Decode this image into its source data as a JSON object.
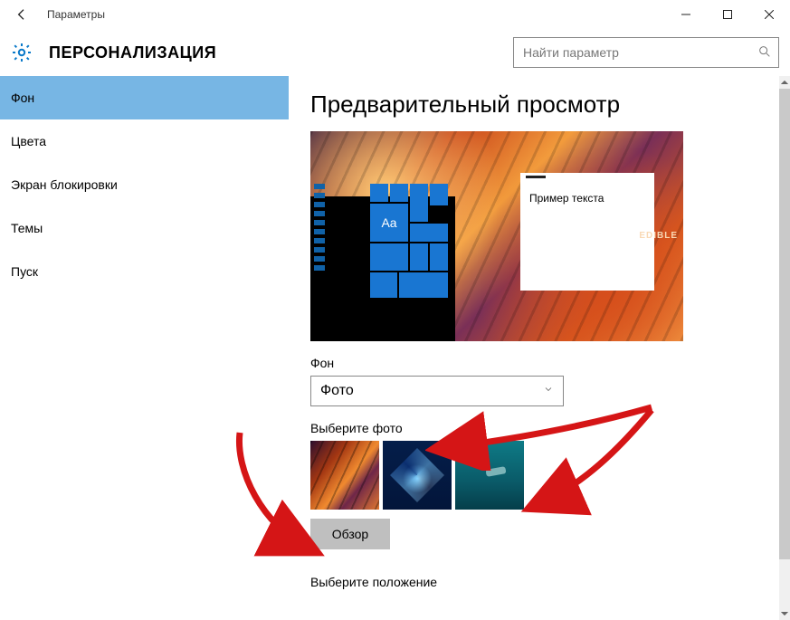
{
  "window": {
    "title": "Параметры"
  },
  "section": {
    "title": "ПЕРСОНАЛИЗАЦИЯ"
  },
  "search": {
    "placeholder": "Найти параметр"
  },
  "sidebar": {
    "items": [
      {
        "label": "Фон",
        "selected": true
      },
      {
        "label": "Цвета",
        "selected": false
      },
      {
        "label": "Экран блокировки",
        "selected": false
      },
      {
        "label": "Темы",
        "selected": false
      },
      {
        "label": "Пуск",
        "selected": false
      }
    ]
  },
  "content": {
    "preview_heading": "Предварительный просмотр",
    "preview_tile_text": "Aa",
    "preview_sample_text": "Пример текста",
    "preview_overlay_word": "EDIBLE",
    "background_label": "Фон",
    "background_dropdown_value": "Фото",
    "choose_photo_label": "Выберите фото",
    "thumbs": [
      {
        "name": "canyon"
      },
      {
        "name": "win10"
      },
      {
        "name": "ocean"
      },
      {
        "name": "blank"
      }
    ],
    "browse_button": "Обзор",
    "choose_fit_label": "Выберите положение"
  }
}
